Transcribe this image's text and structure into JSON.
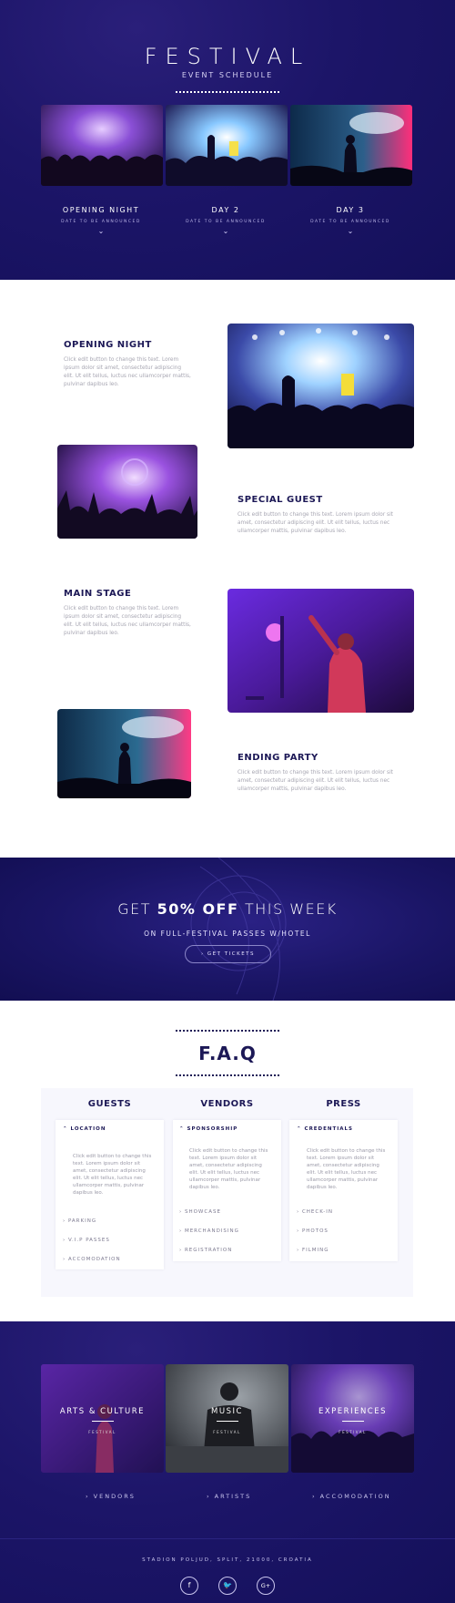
{
  "hero": {
    "title": "FESTIVAL",
    "subtitle": "EVENT SCHEDULE",
    "days": [
      {
        "title": "OPENING NIGHT",
        "sub": "DATE TO BE ANNOUNCED",
        "chev": "⌄"
      },
      {
        "title": "DAY 2",
        "sub": "DATE TO BE ANNOUNCED",
        "chev": "⌄"
      },
      {
        "title": "DAY 3",
        "sub": "DATE TO BE ANNOUNCED",
        "chev": "⌄"
      }
    ]
  },
  "events": [
    {
      "title": "OPENING NIGHT",
      "text": "Click edit button to change this text. Lorem ipsum dolor sit amet, consectetur adipiscing elit. Ut elit tellus, luctus nec ullamcorper mattis, pulvinar dapibus leo."
    },
    {
      "title": "SPECIAL GUEST",
      "text": "Click edit button to change this text. Lorem ipsum dolor sit amet, consectetur adipiscing elit. Ut elit tellus, luctus nec ullamcorper mattis, pulvinar dapibus leo."
    },
    {
      "title": "MAIN STAGE",
      "text": "Click edit button to change this text. Lorem ipsum dolor sit amet, consectetur adipiscing elit. Ut elit tellus, luctus nec ullamcorper mattis, pulvinar dapibus leo."
    },
    {
      "title": "ENDING PARTY",
      "text": "Click edit button to change this text. Lorem ipsum dolor sit amet, consectetur adipiscing elit. Ut elit tellus, luctus nec ullamcorper mattis, pulvinar dapibus leo."
    }
  ],
  "promo": {
    "heading_pre": "GET ",
    "heading_bold": "50% OFF",
    "heading_post": " THIS WEEK",
    "subtitle": "ON FULL-FESTIVAL PASSES W/HOTEL",
    "button": "›  GET TICKETS"
  },
  "faq": {
    "title": "F.A.Q",
    "columns": [
      {
        "heading": "GUESTS",
        "open": "LOCATION",
        "text": "Click edit button to change this text. Lorem ipsum dolor sit amet, consectetur adipiscing elit. Ut elit tellus, luctus nec ullamcorper mattis, pulvinar dapibus leo.",
        "items": [
          "PARKING",
          "V.I.P PASSES",
          "ACCOMODATION"
        ]
      },
      {
        "heading": "VENDORS",
        "open": "SPONSORSHIP",
        "text": "Click edit button to change this text. Lorem ipsum dolor sit amet, consectetur adipiscing elit. Ut elit tellus, luctus nec ullamcorper mattis, pulvinar dapibus leo.",
        "items": [
          "SHOWCASE",
          "MERCHANDISING",
          "REGISTRATION"
        ]
      },
      {
        "heading": "PRESS",
        "open": "CREDENTIALS",
        "text": "Click edit button to change this text. Lorem ipsum dolor sit amet, consectetur adipiscing elit. Ut elit tellus, luctus nec ullamcorper mattis, pulvinar dapibus leo.",
        "items": [
          "CHECK-IN",
          "PHOTOS",
          "FILMING"
        ]
      }
    ]
  },
  "footer": {
    "cards": [
      {
        "label": "ARTS & CULTURE",
        "sub": "FESTIVAL"
      },
      {
        "label": "MUSIC",
        "sub": "FESTIVAL"
      },
      {
        "label": "EXPERIENCES",
        "sub": "FESTIVAL"
      }
    ],
    "links": [
      "›  VENDORS",
      "›  ARTISTS",
      "›  ACCOMODATION"
    ],
    "address": "STADION POLJUD, SPLIT, 21000, CROATIA",
    "social": [
      "f",
      "🐦",
      "G+"
    ]
  },
  "colors": {
    "navy": "#1c1568",
    "title": "#1c1856",
    "body_text": "#a7a6b2"
  }
}
